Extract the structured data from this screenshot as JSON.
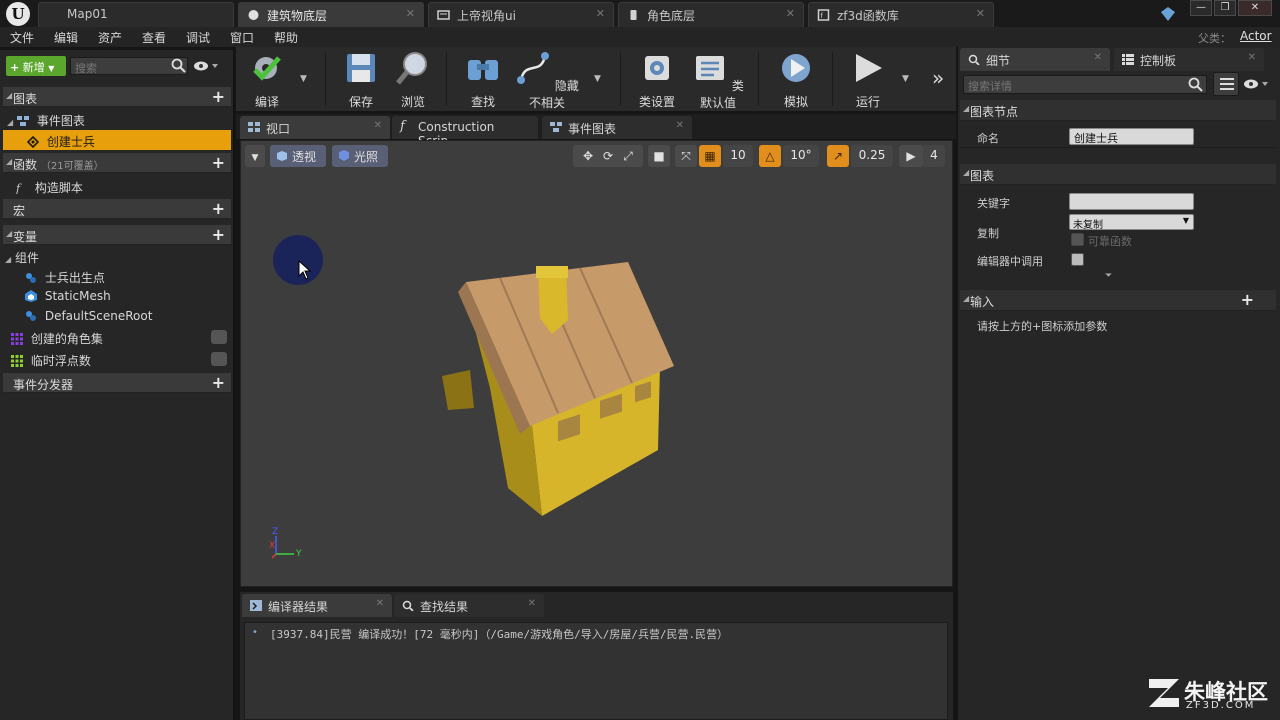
{
  "titlebar": {
    "tabs": [
      {
        "label": "Map01",
        "active": false
      },
      {
        "label": "建筑物底层",
        "active": true
      },
      {
        "label": "上帝视角ui",
        "active": false
      },
      {
        "label": "角色底层",
        "active": false
      },
      {
        "label": "zf3d函数库",
        "active": false
      }
    ],
    "window_controls": [
      "—",
      "❐",
      "✕"
    ]
  },
  "menubar": {
    "items": [
      "文件",
      "编辑",
      "资产",
      "查看",
      "调试",
      "窗口",
      "帮助"
    ],
    "parent_label": "父类：",
    "parent_value": "Actor"
  },
  "left_panel": {
    "add_button": "新增",
    "search_placeholder": "搜索",
    "graphs_header": "图表",
    "event_graph": "事件图表",
    "create_soldier": "创建士兵",
    "functions_header": "函数",
    "functions_override": "（21可覆盖）",
    "construction_script": "构造脚本",
    "macros_header": "宏",
    "variables_header": "变量",
    "components_label": "组件",
    "components": [
      "士兵出生点",
      "StaticMesh",
      "DefaultSceneRoot"
    ],
    "variables": [
      "创建的角色集",
      "临时浮点数"
    ],
    "dispatchers_header": "事件分发器"
  },
  "toolbar": {
    "buttons": [
      "编译",
      "保存",
      "浏览",
      "查找",
      "隐藏不相关",
      "类设置",
      "类默认值",
      "模拟",
      "运行"
    ],
    "more": "»"
  },
  "editor_tabs": [
    "视口",
    "Construction Scrip",
    "事件图表"
  ],
  "viewport": {
    "perspective": "透视",
    "lit": "光照",
    "grid_snap": "10",
    "rotation_snap": "10°",
    "scale_snap": "0.25",
    "camera_speed": "4",
    "axis_z": "Z",
    "axis_x": "X",
    "axis_y": "Y"
  },
  "bottom_panel": {
    "tabs": [
      "编译器结果",
      "查找结果"
    ],
    "log": "[3937.84]民营 编译成功！[72 毫秒内]（/Game/游戏角色/导入/房屋/兵营/民营.民营）"
  },
  "right_panel": {
    "tabs": [
      "细节",
      "控制板"
    ],
    "search_placeholder": "搜索详情",
    "graph_node_header": "图表节点",
    "name_label": "命名",
    "name_value": "创建士兵",
    "graph_header": "图表",
    "keywords_label": "关键字",
    "keywords_value": "",
    "replicate_label": "复制",
    "replicate_value": "未复制",
    "reliable_label": "可靠函数",
    "call_in_editor_label": "编辑器中调用",
    "inputs_header": "输入",
    "inputs_hint": "请按上方的+图标添加参数"
  },
  "watermark": {
    "brand": "朱峰社区",
    "site": "ZF3D.COM"
  }
}
